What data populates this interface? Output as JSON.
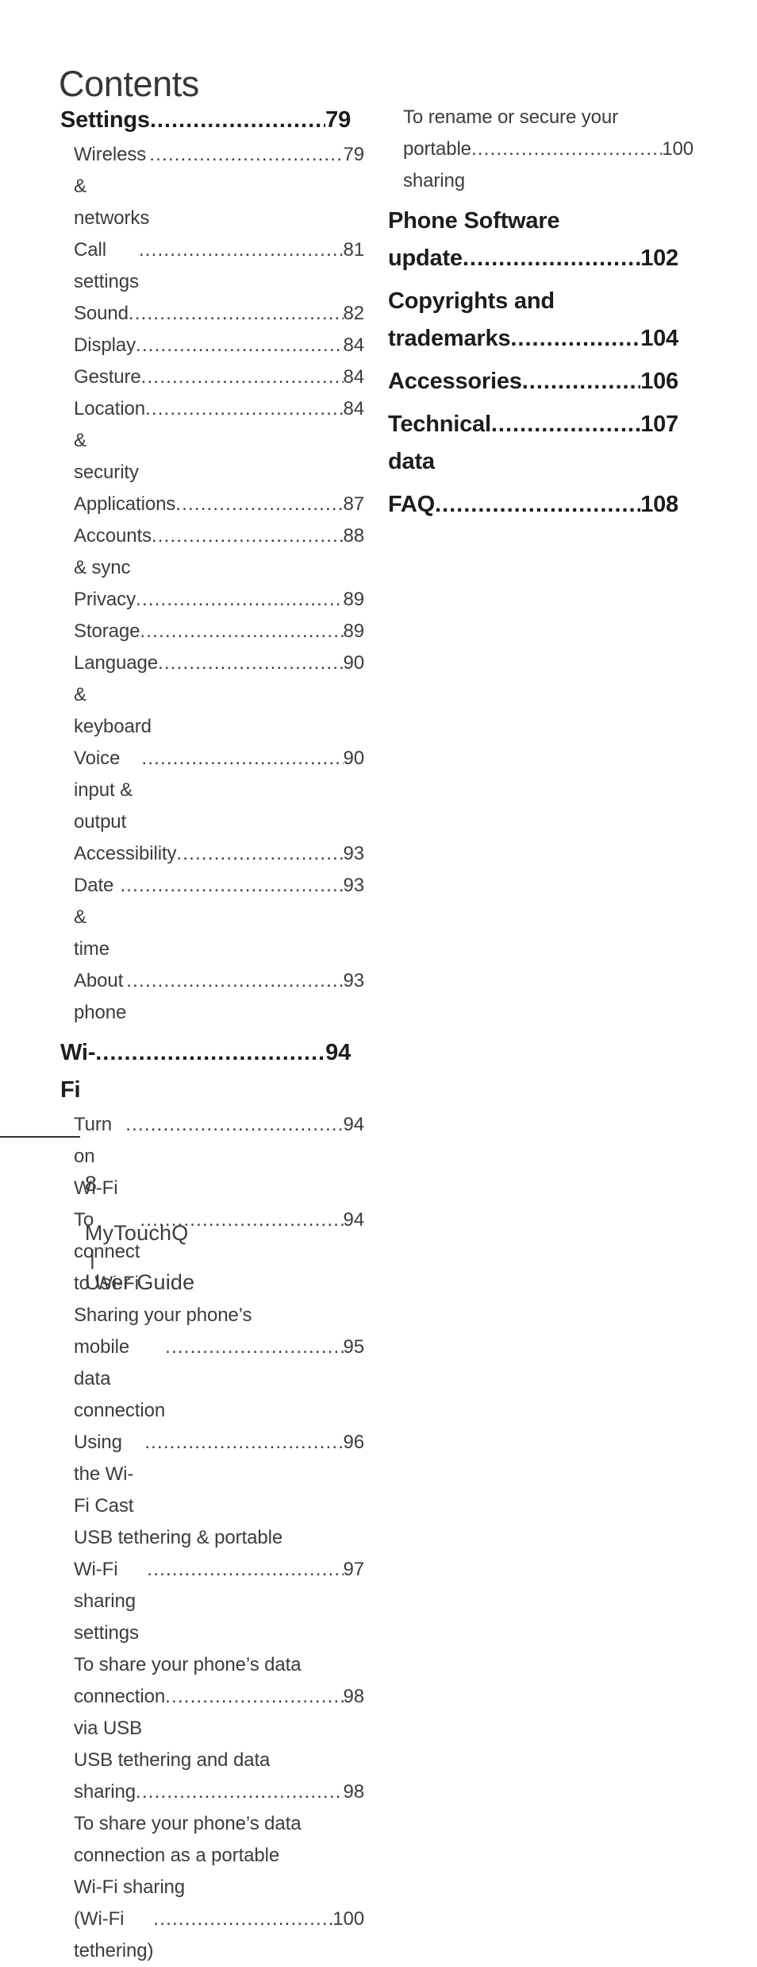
{
  "page_title": "Contents",
  "footer": {
    "page_number": "8",
    "product": "MyTouchQ",
    "separator": "|",
    "doc_type": "User Guide"
  },
  "colors": {
    "background": "#ffffff",
    "chapter_text": "#1d1d1d",
    "section_text": "#3c3c3c",
    "title_text": "#373737",
    "rule": "#333333"
  },
  "columns": {
    "left": [
      {
        "kind": "chapter",
        "lines": [
          "Settings"
        ],
        "page": "79"
      },
      {
        "kind": "section",
        "lines": [
          "Wireless & networks"
        ],
        "page": "79"
      },
      {
        "kind": "section",
        "lines": [
          "Call settings"
        ],
        "page": "81"
      },
      {
        "kind": "section",
        "lines": [
          "Sound"
        ],
        "page": "82"
      },
      {
        "kind": "section",
        "lines": [
          "Display "
        ],
        "page": "84"
      },
      {
        "kind": "section",
        "lines": [
          "Gesture  "
        ],
        "page": "84"
      },
      {
        "kind": "section",
        "lines": [
          "Location & security "
        ],
        "page": "84"
      },
      {
        "kind": "section",
        "lines": [
          "Applications"
        ],
        "page": "87"
      },
      {
        "kind": "section",
        "lines": [
          "Accounts & sync "
        ],
        "page": "88"
      },
      {
        "kind": "section",
        "lines": [
          "Privacy"
        ],
        "page": "89"
      },
      {
        "kind": "section",
        "lines": [
          "Storage "
        ],
        "page": "89"
      },
      {
        "kind": "section",
        "lines": [
          "Language & keyboard"
        ],
        "page": "90"
      },
      {
        "kind": "section",
        "lines": [
          "Voice input & output"
        ],
        "page": "90"
      },
      {
        "kind": "section",
        "lines": [
          "Accessibility"
        ],
        "page": "93"
      },
      {
        "kind": "section",
        "lines": [
          "Date & time "
        ],
        "page": "93"
      },
      {
        "kind": "section",
        "lines": [
          "About phone"
        ],
        "page": "93"
      },
      {
        "kind": "chapter",
        "lines": [
          "Wi-Fi"
        ],
        "page": "94"
      },
      {
        "kind": "section",
        "lines": [
          "Turn on Wi-Fi "
        ],
        "page": "94"
      },
      {
        "kind": "section",
        "lines": [
          "To connect to Wi-Fi"
        ],
        "page": "94"
      },
      {
        "kind": "section",
        "lines": [
          "Sharing your phone’s",
          "mobile data connection"
        ],
        "page": "95"
      },
      {
        "kind": "section",
        "lines": [
          "Using the Wi-Fi Cast "
        ],
        "page": "96"
      },
      {
        "kind": "section",
        "lines": [
          "USB tethering & portable",
          "Wi-Fi sharing settings "
        ],
        "page": "97"
      },
      {
        "kind": "section",
        "lines": [
          "To share your phone’s data",
          "connection via USB"
        ],
        "page": "98"
      },
      {
        "kind": "section",
        "lines": [
          "USB tethering and data",
          "sharing "
        ],
        "page": "98"
      },
      {
        "kind": "section",
        "lines": [
          "To share your phone’s data",
          "connection as a portable",
          "Wi-Fi sharing",
          "(Wi-Fi tethering)"
        ],
        "page": "100"
      }
    ],
    "right": [
      {
        "kind": "section",
        "lines": [
          "To rename or secure your",
          "portable sharing"
        ],
        "page": "100"
      },
      {
        "kind": "chapter",
        "lines": [
          "Phone Software",
          "update"
        ],
        "page": "102"
      },
      {
        "kind": "chapter",
        "lines": [
          "Copyrights and",
          "trademarks "
        ],
        "page": "104"
      },
      {
        "kind": "chapter",
        "lines": [
          "Accessories "
        ],
        "page": "106"
      },
      {
        "kind": "chapter",
        "lines": [
          "Technical data "
        ],
        "page": "107"
      },
      {
        "kind": "chapter",
        "lines": [
          "FAQ "
        ],
        "page": "108"
      }
    ]
  }
}
